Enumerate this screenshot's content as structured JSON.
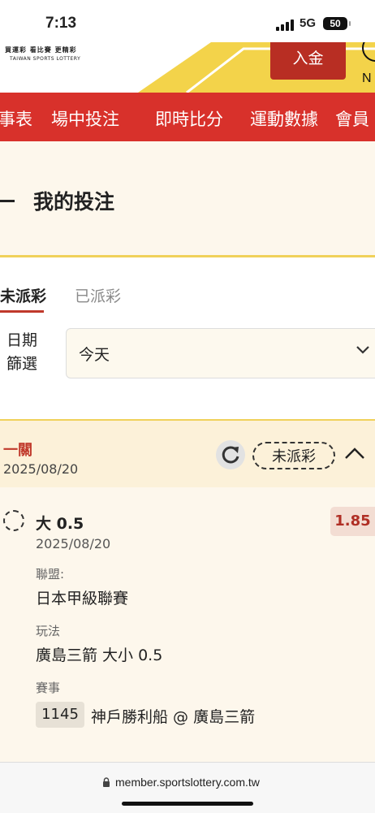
{
  "status_bar": {
    "time": "7:13",
    "network": "5G",
    "battery": "50"
  },
  "header": {
    "logo_line1": "買運彩  看比賽  更精彩",
    "logo_line2": "TAIWAN SPORTS LOTTERY",
    "deposit_label": "入金",
    "user_initial": "N"
  },
  "nav": {
    "items": [
      "事表",
      "場中投注",
      "即時比分",
      "運動數據",
      "會員"
    ]
  },
  "page": {
    "title": "我的投注"
  },
  "tabs": {
    "unsettled": "未派彩",
    "settled": "已派彩"
  },
  "filter": {
    "label": "日期篩選",
    "value": "今天"
  },
  "bet": {
    "type": "一關",
    "date": "2025/08/20",
    "status": "未派彩",
    "selection": "大 0.5",
    "selection_date": "2025/08/20",
    "odds": "1.85",
    "league_label": "聯盟:",
    "league": "日本甲級聯賽",
    "market_label": "玩法",
    "market": "廣島三箭 大小 0.5",
    "match_label": "賽事",
    "match_code": "1145",
    "match": "神戶勝利船 @ 廣島三箭"
  },
  "browser": {
    "url": "member.sportslottery.com.tw"
  },
  "colors": {
    "brand_red": "#d8312b",
    "accent_yellow": "#f0d15a",
    "odds_red": "#b02f25"
  }
}
